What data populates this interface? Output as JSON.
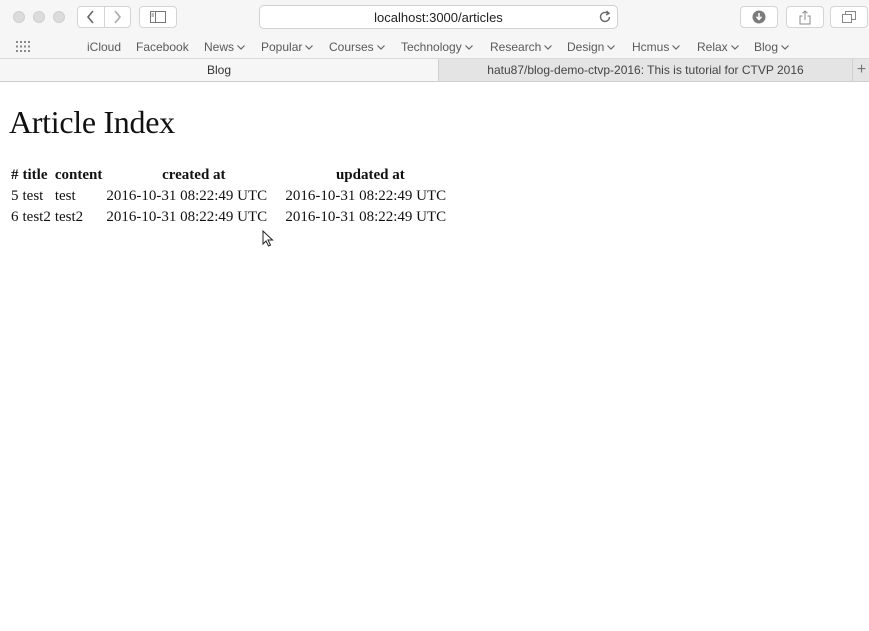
{
  "browser": {
    "url": "localhost:3000/articles",
    "bookmarks": [
      {
        "label": "iCloud",
        "has_menu": false
      },
      {
        "label": "Facebook",
        "has_menu": false
      },
      {
        "label": "News",
        "has_menu": true
      },
      {
        "label": "Popular",
        "has_menu": true
      },
      {
        "label": "Courses",
        "has_menu": true
      },
      {
        "label": "Technology",
        "has_menu": true
      },
      {
        "label": "Research",
        "has_menu": true
      },
      {
        "label": "Design",
        "has_menu": true
      },
      {
        "label": "Hcmus",
        "has_menu": true
      },
      {
        "label": "Relax",
        "has_menu": true
      },
      {
        "label": "Blog",
        "has_menu": true
      }
    ],
    "tabs": [
      {
        "label": "Blog",
        "active": true
      },
      {
        "label": "hatu87/blog-demo-ctvp-2016: This is tutorial for CTVP 2016",
        "active": false
      }
    ],
    "new_tab_glyph": "+"
  },
  "page": {
    "heading": "Article Index",
    "table": {
      "headers": [
        "#",
        "title",
        "content",
        "created at",
        "updated at"
      ],
      "rows": [
        [
          "5",
          "test",
          "test",
          "2016-10-31 08:22:49 UTC",
          "2016-10-31 08:22:49 UTC"
        ],
        [
          "6",
          "test2",
          "test2",
          "2016-10-31 08:22:49 UTC",
          "2016-10-31 08:22:49 UTC"
        ]
      ]
    }
  },
  "icons": {
    "back": "chevron-left-icon",
    "forward": "chevron-right-icon",
    "sidebar": "sidebar-icon",
    "reload": "reload-icon",
    "downloads": "download-icon",
    "share": "share-icon",
    "tabs_overview": "tabs-overview-icon",
    "top_sites": "grid-icon",
    "cursor": "mouse-pointer-icon"
  },
  "colors": {
    "chrome_bg": "#f6f6f6",
    "tab_inactive_bg": "#e4e4e4",
    "page_bg": "#ffffff"
  }
}
